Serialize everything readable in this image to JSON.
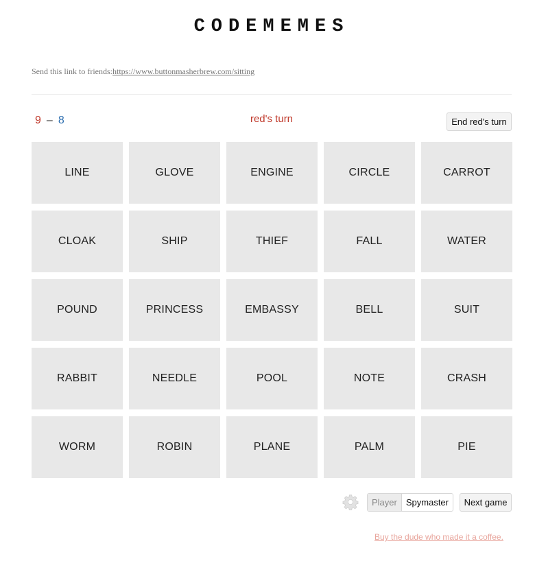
{
  "app": {
    "title": "CODEMEMES"
  },
  "share": {
    "prefix": "Send this link to friends:",
    "link": "https://www.buttonmasherbrew.com/sitting"
  },
  "scoreboard": {
    "red_score": "9",
    "separator": "–",
    "blue_score": "8",
    "turn_label": "red's turn",
    "end_turn_label": "End red's turn"
  },
  "colors": {
    "red": "#c0392b",
    "blue": "#2e6fb0",
    "card_bg": "#e8e8e8"
  },
  "board": {
    "cards": [
      "LINE",
      "GLOVE",
      "ENGINE",
      "CIRCLE",
      "CARROT",
      "CLOAK",
      "SHIP",
      "THIEF",
      "FALL",
      "WATER",
      "POUND",
      "PRINCESS",
      "EMBASSY",
      "BELL",
      "SUIT",
      "RABBIT",
      "NEEDLE",
      "POOL",
      "NOTE",
      "CRASH",
      "WORM",
      "ROBIN",
      "PLANE",
      "PALM",
      "PIE"
    ]
  },
  "controls": {
    "settings_icon": "gear-icon",
    "player_label": "Player",
    "spymaster_label": "Spymaster",
    "next_game_label": "Next game"
  },
  "footer": {
    "coffee_link": "Buy the dude who made it a coffee."
  }
}
